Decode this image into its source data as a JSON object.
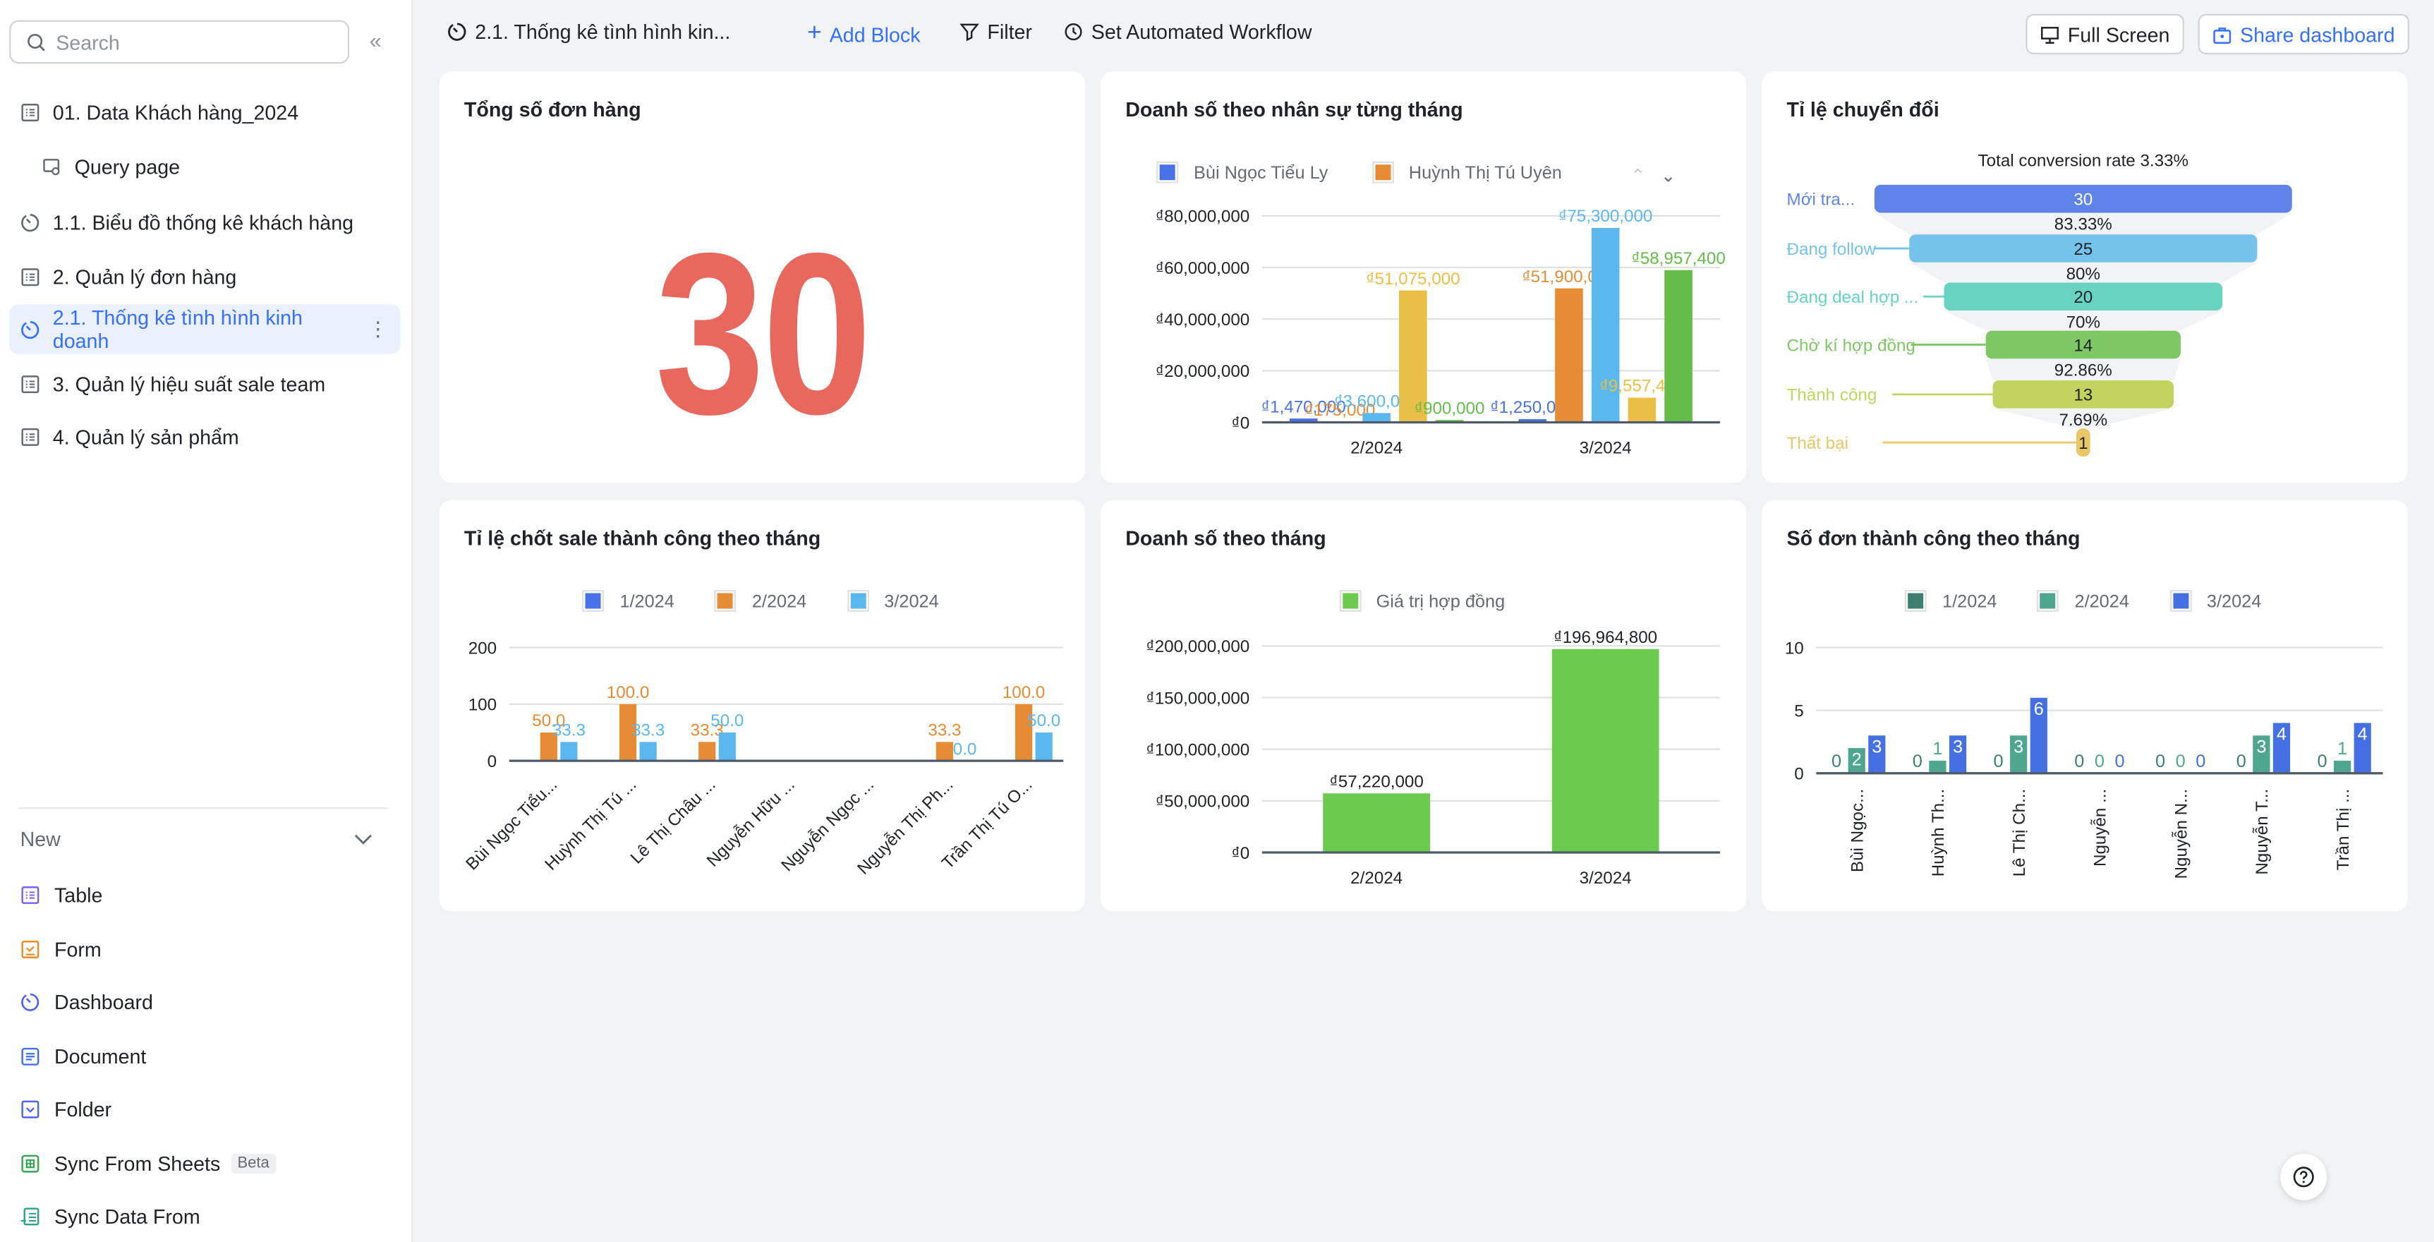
{
  "sidebar": {
    "search_placeholder": "Search",
    "items": [
      {
        "label": "01. Data Khách hàng_2024",
        "icon": "table-icon"
      },
      {
        "label": "Query page",
        "icon": "query-icon"
      },
      {
        "label": "1.1. Biểu đồ thống kê khách hàng",
        "icon": "dashboard-icon"
      },
      {
        "label": "2. Quản lý đơn hàng",
        "icon": "table-icon"
      },
      {
        "label": "2.1. Thống kê tình hình kinh doanh",
        "icon": "dashboard-icon",
        "active": true
      },
      {
        "label": "3. Quản lý hiệu suất sale team",
        "icon": "table-icon"
      },
      {
        "label": "4. Quản lý sản phẩm",
        "icon": "table-icon"
      }
    ],
    "new_label": "New",
    "new_items": [
      {
        "label": "Table",
        "color": "#7b5ff0"
      },
      {
        "label": "Form",
        "color": "#f08a24"
      },
      {
        "label": "Dashboard",
        "color": "#4f63f0"
      },
      {
        "label": "Document",
        "color": "#3f6ff0"
      },
      {
        "label": "Folder",
        "color": "#4f63f0"
      },
      {
        "label": "Sync From Sheets",
        "badge": "Beta",
        "color": "#34a853"
      },
      {
        "label": "Sync Data From",
        "color": "#2ea38b"
      }
    ]
  },
  "topbar": {
    "title": "2.1. Thống kê tình hình kin...",
    "add_block": "Add Block",
    "filter": "Filter",
    "workflow": "Set Automated Workflow",
    "full_screen": "Full Screen",
    "share": "Share dashboard",
    "accent": "#3370ff"
  },
  "cards": {
    "total_orders": {
      "title": "Tổng số đơn hàng",
      "value": "30",
      "color": "#e8685e"
    },
    "sales_by_staff": {
      "title": "Doanh số theo nhân sự từng tháng"
    },
    "conversion": {
      "title": "Tỉ lệ chuyển đổi"
    },
    "close_rate": {
      "title": "Tỉ lệ chốt sale thành công theo tháng"
    },
    "monthly_sales": {
      "title": "Doanh số theo tháng"
    },
    "success_orders": {
      "title": "Số đơn thành công theo tháng"
    }
  },
  "chart_data": [
    {
      "type": "bar",
      "categories": [
        "2/2024",
        "3/2024"
      ],
      "y_tick_labels": [
        "₫0",
        "₫20,000,000",
        "₫40,000,000",
        "₫60,000,000",
        "₫80,000,000"
      ],
      "ylim": [
        0,
        80000000
      ],
      "grid": true,
      "legend_visible": [
        "Bùi Ngọc Tiểu Ly",
        "Huỳnh Thị Tú Uyên"
      ],
      "legend_paginated": true,
      "series": [
        {
          "name": "Bùi Ngọc Tiểu Ly",
          "color": "#4a72e8",
          "values": [
            1470000,
            1250000
          ]
        },
        {
          "name": "Huỳnh Thị Tú Uyên",
          "color": "#e58c35",
          "values": [
            175000,
            51900000
          ]
        },
        {
          "color": "#5bb8ef",
          "values": [
            3600000,
            75300000
          ]
        },
        {
          "color": "#eabf45",
          "values": [
            51075000,
            9557400
          ]
        },
        {
          "color": "#63bd48",
          "values": [
            900000,
            58957400
          ]
        }
      ]
    },
    {
      "type": "funnel",
      "subtitle": "Total conversion rate 3.33%",
      "stages": [
        {
          "name": "Mới tra...",
          "value": 30,
          "color": "#6083ea"
        },
        {
          "name": "Đang follow",
          "value": 25,
          "color": "#75c3eb"
        },
        {
          "name": "Đang deal hợp ...",
          "value": 20,
          "color": "#67d3c0"
        },
        {
          "name": "Chờ kí hợp đồng",
          "value": 14,
          "color": "#7dc765"
        },
        {
          "name": "Thành công",
          "value": 13,
          "color": "#c2d35f"
        },
        {
          "name": "Thất bại",
          "value": 1,
          "color": "#eac766"
        }
      ],
      "step_rates": [
        "83.33%",
        "80%",
        "70%",
        "92.86%",
        "7.69%"
      ]
    },
    {
      "type": "bar",
      "categories": [
        "Bùi Ngọc Tiểu...",
        "Huỳnh Thị Tú ...",
        "Lê Thị Châu ...",
        "Nguyễn Hữu ...",
        "Nguyễn Ngọc ...",
        "Nguyễn Thị Ph...",
        "Trần Thị Tú O..."
      ],
      "y_tick_labels": [
        "0",
        "100",
        "200"
      ],
      "ylim": [
        0,
        200
      ],
      "grid": true,
      "legend": "top",
      "series": [
        {
          "name": "1/2024",
          "color": "#4a72e8",
          "values": [
            null,
            null,
            null,
            null,
            null,
            null,
            null
          ]
        },
        {
          "name": "2/2024",
          "color": "#e58c35",
          "values": [
            50.0,
            100.0,
            33.3,
            null,
            null,
            33.3,
            100.0
          ]
        },
        {
          "name": "3/2024",
          "color": "#5bb8ef",
          "values": [
            33.3,
            33.3,
            50.0,
            null,
            null,
            0.0,
            50.0
          ]
        }
      ]
    },
    {
      "type": "bar",
      "categories": [
        "2/2024",
        "3/2024"
      ],
      "y_tick_labels": [
        "₫0",
        "₫50,000,000",
        "₫100,000,000",
        "₫150,000,000",
        "₫200,000,000"
      ],
      "ylim": [
        0,
        200000000
      ],
      "grid": true,
      "legend": "top",
      "series": [
        {
          "name": "Giá trị hợp đồng",
          "color": "#6bcb4e",
          "values": [
            57220000,
            196964800
          ]
        }
      ]
    },
    {
      "type": "bar",
      "categories": [
        "Bùi Ngọc...",
        "Huỳnh Th...",
        "Lê Thị Ch...",
        "Nguyễn ...",
        "Nguyễn N...",
        "Nguyễn T...",
        "Trần Thị ..."
      ],
      "y_tick_labels": [
        "0",
        "5",
        "10"
      ],
      "ylim": [
        0,
        10
      ],
      "grid": true,
      "legend": "top",
      "series": [
        {
          "name": "1/2024",
          "color": "#3d8070",
          "values": [
            0,
            0,
            0,
            0,
            0,
            0,
            0
          ]
        },
        {
          "name": "2/2024",
          "color": "#4ea68e",
          "values": [
            2,
            1,
            3,
            0,
            0,
            3,
            1
          ]
        },
        {
          "name": "3/2024",
          "color": "#4470e3",
          "values": [
            3,
            3,
            6,
            0,
            0,
            4,
            4
          ]
        }
      ]
    }
  ]
}
